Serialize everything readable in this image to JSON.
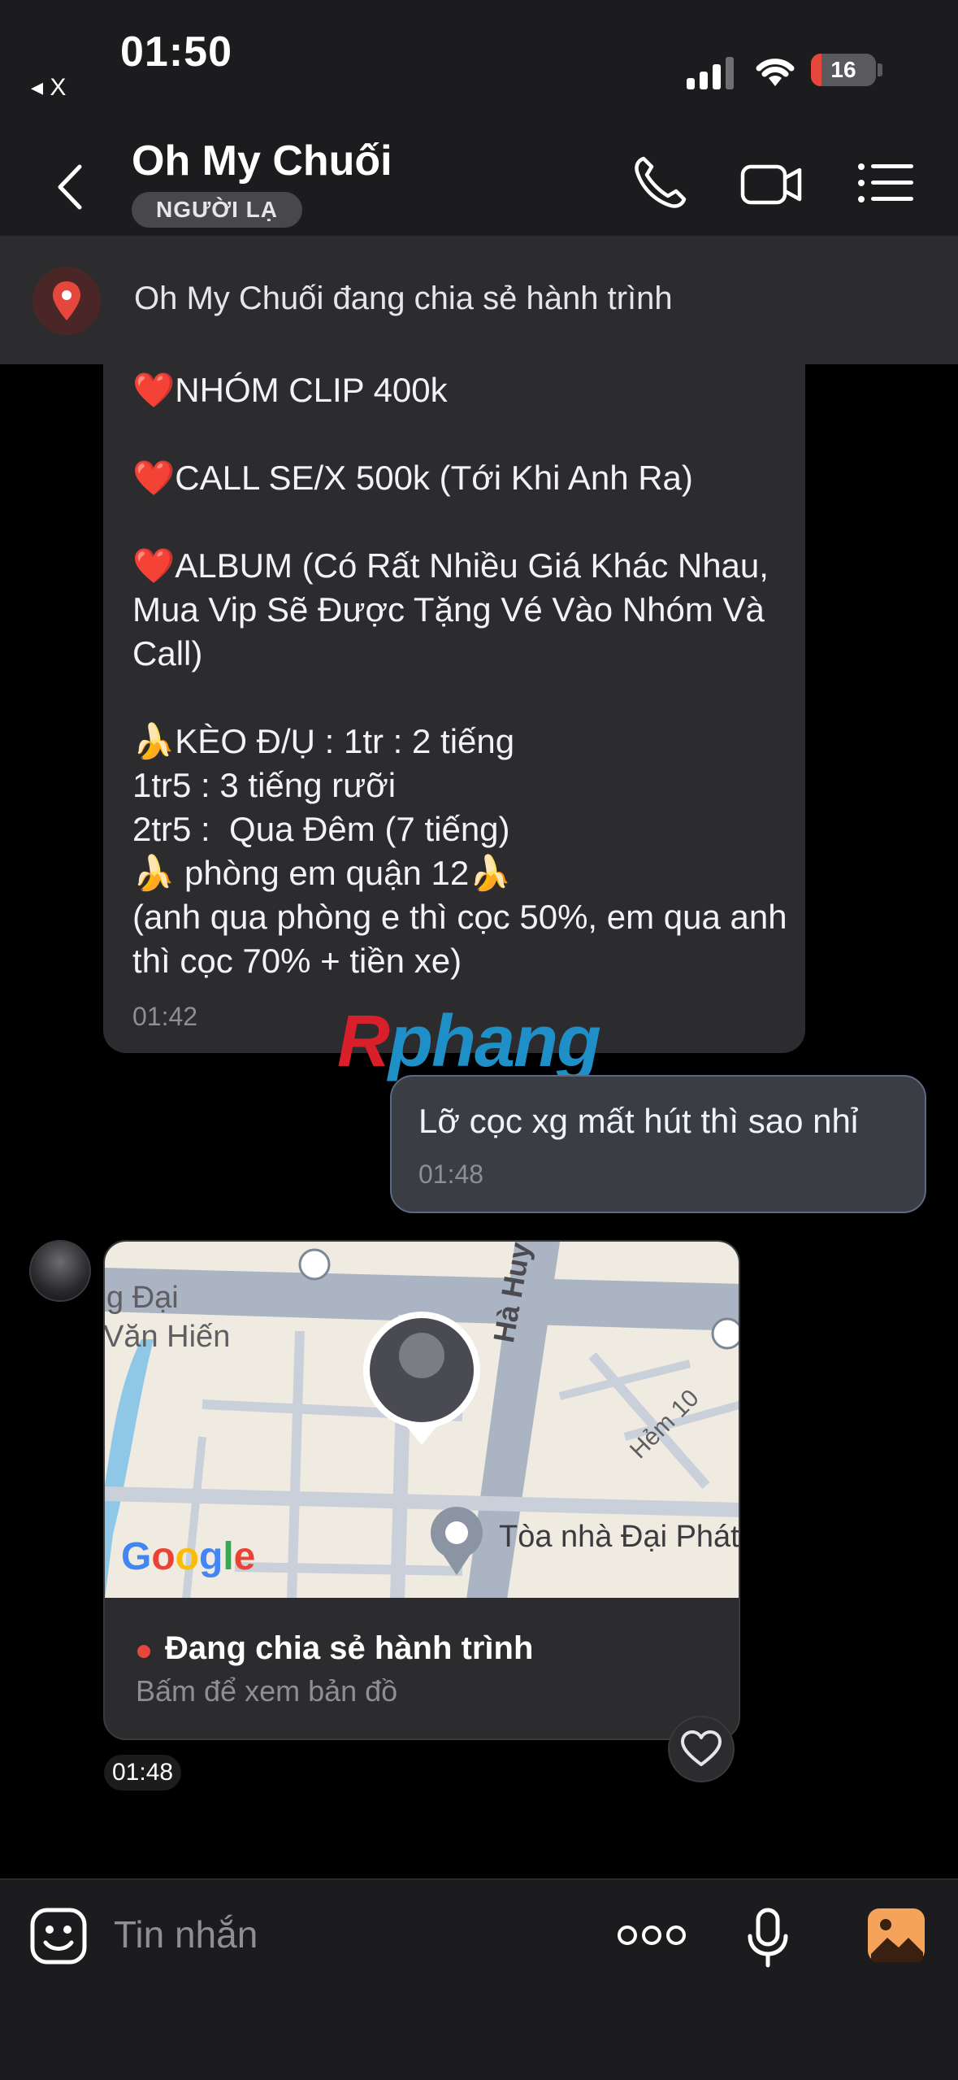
{
  "status": {
    "time": "01:50",
    "back_app": "◂ X",
    "battery": "16",
    "battery_level": 0.16
  },
  "header": {
    "name": "Oh My Chuối",
    "badge": "NGƯỜI LẠ"
  },
  "banner": {
    "text": "Oh My Chuối đang chia sẻ hành trình"
  },
  "messages": {
    "incoming_text": "❤️NHÓM CLIP 400k\n\n❤️CALL SE/X 500k (Tới Khi Anh Ra)\n\n❤️ALBUM (Có Rất Nhiều Giá Khác Nhau, Mua Vip Sẽ Được Tặng Vé Vào Nhóm Và Call)\n\n🍌KÈO Đ/Ụ : 1tr : 2 tiếng\n1tr5 : 3 tiếng rưỡi\n2tr5 :  Qua Đêm (7 tiếng)\n🍌 phòng em quận 12🍌\n(anh qua phòng e thì cọc 50%, em qua anh thì cọc 70% + tiền xe)",
    "incoming_time": "01:42",
    "outgoing_text": "Lỡ cọc xg mất hút thì sao nhỉ",
    "outgoing_time": "01:48"
  },
  "watermark": {
    "part1": "R",
    "part2": "phang"
  },
  "map": {
    "label_area1": "g Đại",
    "label_area2": "Văn Hiến",
    "label_street": "Hà Huy Giáp",
    "label_alley": "Hẻm 10",
    "place": "Tòa nhà Đại Phát",
    "provider": "Google",
    "live_title": "Đang chia sẻ hành trình",
    "live_sub": "Bấm để xem bản đồ",
    "time": "01:48"
  },
  "composer": {
    "placeholder": "Tin nhắn"
  },
  "colors": {
    "background": "#000000",
    "bubble": "#2c2c2e",
    "outgoing_border": "#5b6a82",
    "accent_red": "#e5473c",
    "gallery_orange": "#f5a25a"
  }
}
